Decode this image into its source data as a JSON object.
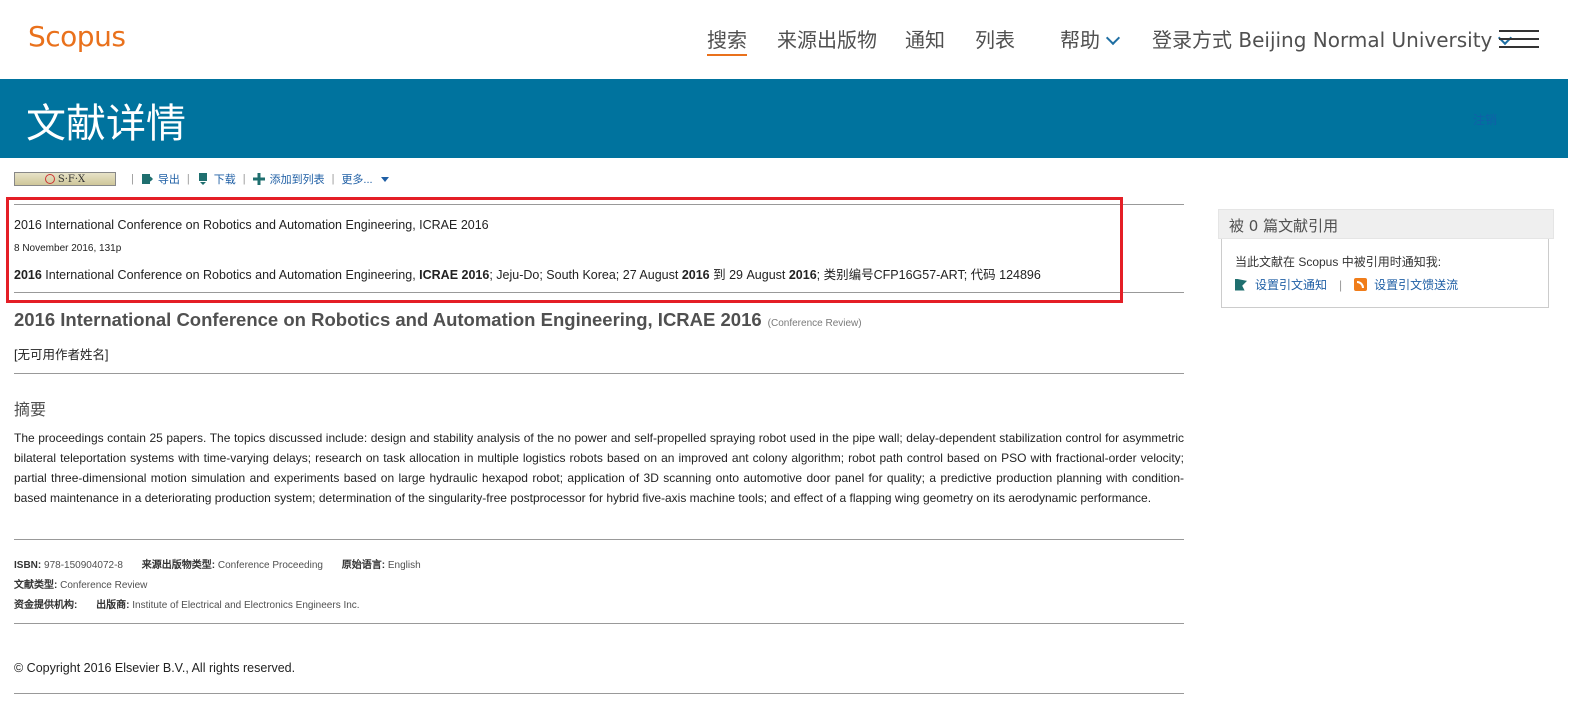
{
  "header": {
    "logo": "Scopus",
    "nav": [
      "搜索",
      "来源出版物",
      "通知",
      "列表"
    ],
    "help": "帮助",
    "login": "登录方式 Beijing Normal University"
  },
  "banner": {
    "title": "文献详情",
    "link": "注销"
  },
  "toolbar": {
    "sfx": "S·F·X",
    "export": "导出",
    "download": "下载",
    "add_to_list": "添加到列表",
    "more": "更多..."
  },
  "source": {
    "line1": "2016 International Conference on Robotics and Automation Engineering, ICRAE 2016",
    "line2": "8 November 2016, 131p",
    "line3": {
      "p1": "2016",
      "p2": " International Conference on Robotics and Automation Engineering, ",
      "p3": "ICRAE 2016",
      "p4": "; Jeju-Do; South Korea; 27 August ",
      "p5": "2016",
      "p6": " 到 29 August ",
      "p7": "2016",
      "p8": "; 类别编号CFP16G57-ART; 代码 124896"
    }
  },
  "document": {
    "title": "2016 International Conference on Robotics and Automation Engineering, ICRAE 2016",
    "type_tag": "(Conference Review)",
    "authors": "[无可用作者姓名]",
    "abstract_heading": "摘要",
    "abstract": "The proceedings contain 25 papers. The topics discussed include: design and stability analysis of the no power and self-propelled spraying robot used in the pipe wall; delay-dependent stabilization control for asymmetric bilateral teleportation systems with time-varying delays; research on task allocation in multiple logistics robots based on an improved ant colony algorithm; robot path control based on PSO with fractional-order velocity; partial three-dimensional motion simulation and experiments based on large hydraulic hexapod robot; application of 3D scanning onto automotive door panel for quality; a predictive production planning with condition-based maintenance in a deteriorating production system; determination of the singularity-free postprocessor for hybrid five-axis machine tools; and effect of a flapping wing geometry on its aerodynamic performance."
  },
  "meta": {
    "isbn_label": "ISBN:",
    "isbn": "978-150904072-8",
    "source_type_label": "来源出版物类型:",
    "source_type": "Conference Proceeding",
    "language_label": "原始语言:",
    "language": "English",
    "doc_type_label": "文献类型:",
    "doc_type": "Conference Review",
    "funding_label": "资金提供机构:",
    "publisher_label": "出版商:",
    "publisher": "Institute of Electrical and Electronics Engineers Inc."
  },
  "copyright": "© Copyright 2016 Elsevier B.V., All rights reserved.",
  "cited_by": {
    "title": "被 0 篇文献引用",
    "note": "当此文献在 Scopus 中被引用时通知我:",
    "alert": "设置引文通知",
    "feed": "设置引文馈送流"
  }
}
